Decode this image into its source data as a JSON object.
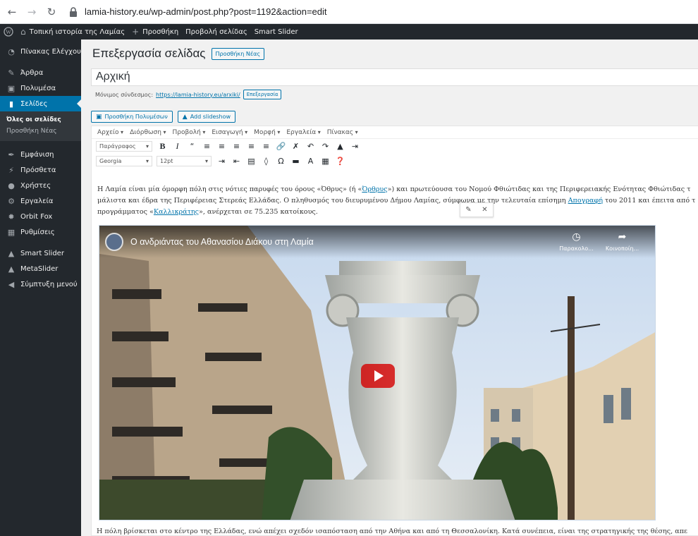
{
  "browser": {
    "url": "lamia-history.eu/wp-admin/post.php?post=1192&action=edit"
  },
  "adminbar": {
    "site_name": "Τοπική ιστορία της Λαμίας",
    "new_label": "Προσθήκη",
    "view_page": "Προβολή σελίδας",
    "smart_slider": "Smart Slider"
  },
  "sidebar": {
    "items": [
      {
        "label": "Πίνακας Ελέγχου",
        "icon": "dashboard-icon"
      },
      {
        "label": "Άρθρα",
        "icon": "pin-icon"
      },
      {
        "label": "Πολυμέσα",
        "icon": "media-icon"
      },
      {
        "label": "Σελίδες",
        "icon": "pages-icon"
      },
      {
        "label": "Εμφάνιση",
        "icon": "brush-icon"
      },
      {
        "label": "Πρόσθετα",
        "icon": "plugin-icon"
      },
      {
        "label": "Χρήστες",
        "icon": "users-icon"
      },
      {
        "label": "Εργαλεία",
        "icon": "wrench-icon"
      },
      {
        "label": "Orbit Fox",
        "icon": "fox-icon"
      },
      {
        "label": "Ρυθμίσεις",
        "icon": "settings-icon"
      },
      {
        "label": "Smart Slider",
        "icon": "slider-icon"
      },
      {
        "label": "MetaSlider",
        "icon": "metaslider-icon"
      },
      {
        "label": "Σύμπτυξη μενού",
        "icon": "collapse-icon"
      }
    ],
    "submenu": [
      "Όλες οι σελίδες",
      "Προσθήκη Νέας"
    ]
  },
  "page": {
    "title": "Επεξεργασία σελίδας",
    "add_new": "Προσθήκη Νέας",
    "post_title": "Αρχική",
    "permalink_label": "Μόνιμος σύνδεσμος:",
    "permalink_url": "https://lamia-history.eu/arxiki/",
    "edit_button": "Επεξεργασία",
    "add_media": "Προσθήκη Πολυμέσων",
    "add_slideshow": "Add slideshow"
  },
  "editor": {
    "menus": [
      "Αρχείο",
      "Διόρθωση",
      "Προβολή",
      "Εισαγωγή",
      "Μορφή",
      "Εργαλεία",
      "Πίνακας"
    ],
    "format_select": "Παράγραφος",
    "font_select": "Georgia",
    "size_select": "12pt",
    "para1_line1_a": "Η Λαμία είναι μία όμορφη πόλη στις νότιες παρυφές του όρους «Όθρυς» (ή «",
    "para1_link1": "Όρθρυς",
    "para1_line1_b": "») και πρωτεύουσα του Νομού Φθιώτιδας και της Περιφερειακής Ενότητας Φθιώτιδας τ",
    "para1_line2_a": "μάλιστα και έδρα της Περιφέρειας Στερεάς Ελλάδας. Ο πληθυσμός του διευρυμένου Δήμου Λαμίας, σύμφωνα με την τελευταία επίσημη ",
    "para1_link2": "Απογραφή",
    "para1_line2_b": " του 2011 και έπειτα από τ",
    "para1_line3_a": "προγράμματος «",
    "para1_link3": "Καλλικράτης",
    "para1_line3_b": "», ανέρχεται σε 75.235 κατοίκους.",
    "para2": "Η πόλη βρίσκεται στο κέντρο της Ελλάδας, ενώ απέχει σχεδόν ισαπόσταση από την Αθήνα και από τη Θεσσαλονίκη. Κατά συνέπεια, είναι της στρατηγικής της θέσης, απε"
  },
  "video": {
    "title": "Ο ανδριάντας του Αθανασίου Διάκου στη Λαμία",
    "watch_later": "Παρακολο...",
    "share": "Κοινοποίη..."
  }
}
